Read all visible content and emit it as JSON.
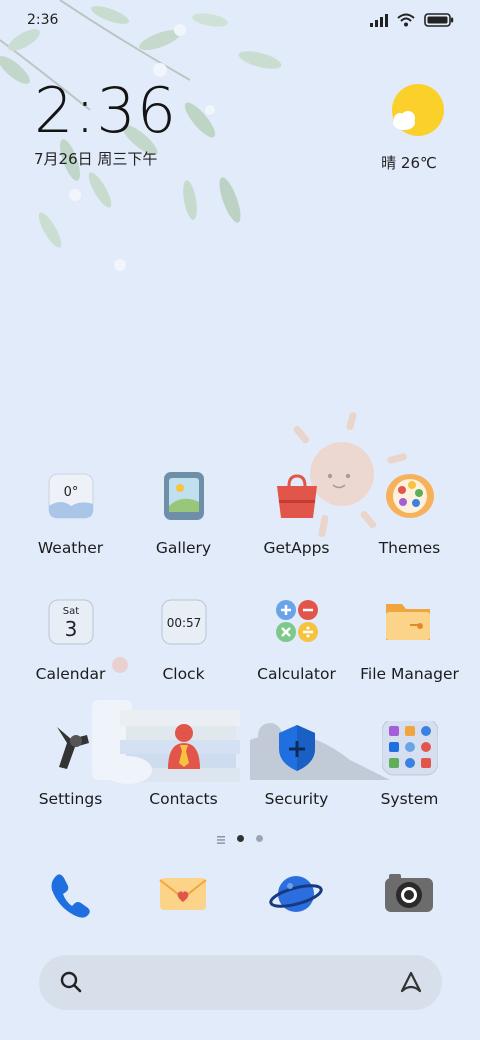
{
  "status": {
    "time": "2:36",
    "icons": [
      "signal-icon",
      "wifi-icon",
      "battery-icon"
    ]
  },
  "clock_widget": {
    "time": "2:36",
    "date": "7月26日 周三下午"
  },
  "weather_widget": {
    "icon": "sun-cloud-icon",
    "text": "晴 26℃"
  },
  "apps_row1": [
    {
      "label": "Weather",
      "icon": "weather-icon",
      "icon_text": "0°"
    },
    {
      "label": "Gallery",
      "icon": "gallery-icon"
    },
    {
      "label": "GetApps",
      "icon": "getapps-icon"
    },
    {
      "label": "Themes",
      "icon": "themes-icon"
    }
  ],
  "apps_row2": [
    {
      "label": "Calendar",
      "icon": "calendar-icon",
      "icon_day": "Sat",
      "icon_date": "3"
    },
    {
      "label": "Clock",
      "icon": "clock-icon",
      "icon_text": "00:57"
    },
    {
      "label": "Calculator",
      "icon": "calculator-icon"
    },
    {
      "label": "File Manager",
      "icon": "file-manager-icon"
    }
  ],
  "apps_row3": [
    {
      "label": "Settings",
      "icon": "settings-icon"
    },
    {
      "label": "Contacts",
      "icon": "contacts-icon"
    },
    {
      "label": "Security",
      "icon": "security-icon"
    },
    {
      "label": "System",
      "icon": "system-folder-icon"
    }
  ],
  "page_indicator": {
    "pages": 2,
    "current": 1
  },
  "dock": [
    "phone-icon",
    "messaging-icon",
    "browser-icon",
    "camera-icon"
  ],
  "search_bar": {
    "left_icon": "search-icon",
    "right_icon": "assistant-icon"
  },
  "colors": {
    "background": "#e2ebf9",
    "sun": "#fbd02a",
    "accent_blue": "#1f6fe0"
  }
}
